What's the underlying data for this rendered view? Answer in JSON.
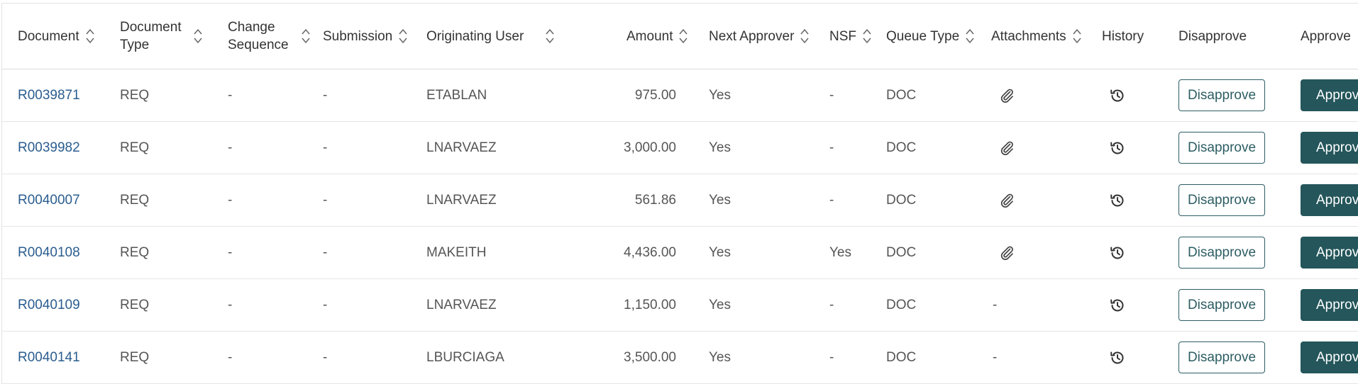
{
  "table": {
    "headers": {
      "document": "Document",
      "document_type": "Document Type",
      "change_sequence": "Change Sequence",
      "submission": "Submission",
      "originating_user": "Originating User",
      "amount": "Amount",
      "next_approver": "Next Approver",
      "nsf": "NSF",
      "queue_type": "Queue Type",
      "attachments": "Attachments",
      "history": "History",
      "disapprove": "Disapprove",
      "approve": "Approve"
    },
    "rows": [
      {
        "document": "R0039871",
        "document_type": "REQ",
        "change_sequence": "-",
        "submission": "-",
        "originating_user": "ETABLAN",
        "amount": "975.00",
        "next_approver": "Yes",
        "nsf": "-",
        "queue_type": "DOC",
        "attachments": "paperclip-icon",
        "history": "history-icon",
        "disapprove": "Disapprove",
        "approve": "Approve"
      },
      {
        "document": "R0039982",
        "document_type": "REQ",
        "change_sequence": "-",
        "submission": "-",
        "originating_user": "LNARVAEZ",
        "amount": "3,000.00",
        "next_approver": "Yes",
        "nsf": "-",
        "queue_type": "DOC",
        "attachments": "paperclip-icon",
        "history": "history-icon",
        "disapprove": "Disapprove",
        "approve": "Approve"
      },
      {
        "document": "R0040007",
        "document_type": "REQ",
        "change_sequence": "-",
        "submission": "-",
        "originating_user": "LNARVAEZ",
        "amount": "561.86",
        "next_approver": "Yes",
        "nsf": "-",
        "queue_type": "DOC",
        "attachments": "paperclip-icon",
        "history": "history-icon",
        "disapprove": "Disapprove",
        "approve": "Approve"
      },
      {
        "document": "R0040108",
        "document_type": "REQ",
        "change_sequence": "-",
        "submission": "-",
        "originating_user": "MAKEITH",
        "amount": "4,436.00",
        "next_approver": "Yes",
        "nsf": "Yes",
        "queue_type": "DOC",
        "attachments": "paperclip-icon",
        "history": "history-icon",
        "disapprove": "Disapprove",
        "approve": "Approve"
      },
      {
        "document": "R0040109",
        "document_type": "REQ",
        "change_sequence": "-",
        "submission": "-",
        "originating_user": "LNARVAEZ",
        "amount": "1,150.00",
        "next_approver": "Yes",
        "nsf": "-",
        "queue_type": "DOC",
        "attachments": "-",
        "history": "history-icon",
        "disapprove": "Disapprove",
        "approve": "Approve"
      },
      {
        "document": "R0040141",
        "document_type": "REQ",
        "change_sequence": "-",
        "submission": "-",
        "originating_user": "LBURCIAGA",
        "amount": "3,500.00",
        "next_approver": "Yes",
        "nsf": "-",
        "queue_type": "DOC",
        "attachments": "-",
        "history": "history-icon",
        "disapprove": "Disapprove",
        "approve": "Approve"
      }
    ]
  },
  "colors": {
    "link": "#2a5d8f",
    "primary_button": "#24565b",
    "outline_button": "#2c5d63",
    "border": "#e6e6e6"
  }
}
